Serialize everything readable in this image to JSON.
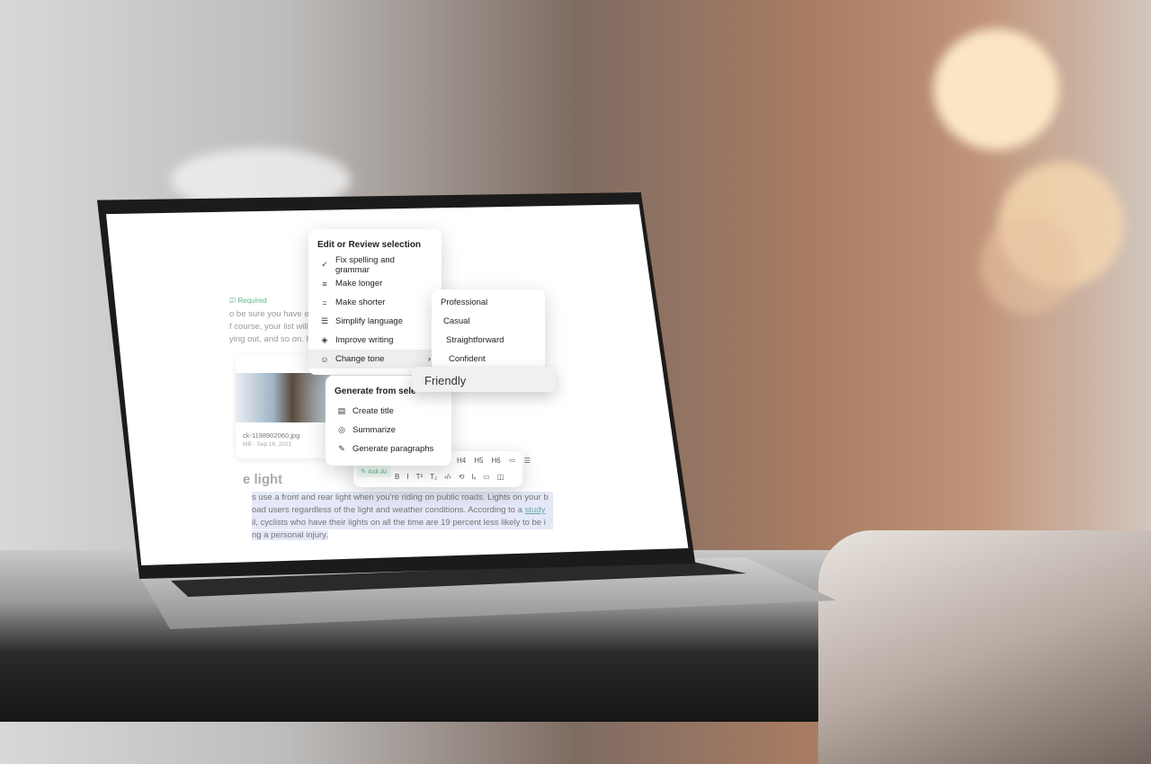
{
  "menu": {
    "edit_header": "Edit or Review selection",
    "items": [
      {
        "icon": "check-icon",
        "label": "Fix spelling and grammar"
      },
      {
        "icon": "lines-icon",
        "label": "Make longer"
      },
      {
        "icon": "short-lines-icon",
        "label": "Make shorter"
      },
      {
        "icon": "align-icon",
        "label": "Simplify language"
      },
      {
        "icon": "gem-icon",
        "label": "Improve writing"
      },
      {
        "icon": "smile-icon",
        "label": "Change tone"
      }
    ],
    "generate_header": "Generate from sele",
    "generate_items": [
      {
        "icon": "title-icon",
        "label": "Create title"
      },
      {
        "icon": "summary-icon",
        "label": "Summarize"
      },
      {
        "icon": "pen-icon",
        "label": "Generate paragraphs"
      }
    ]
  },
  "tone_menu": {
    "items": [
      "Professional",
      "Casual",
      "Straightforward",
      "Confident"
    ],
    "hovered": "Friendly"
  },
  "doc": {
    "required": "Required",
    "intro_lines": [
      "o be sure you have eve",
      "f course, your list will v",
      "ying out, and so on. Ho"
    ],
    "image_name": "ck-1198902060.jpg",
    "image_meta": "MB · Sep 16, 2021",
    "heading": "e light",
    "para_lines": [
      "s use a front and rear light when you're riding on public roads. Lights on your b",
      "oad users regardless of the light and weather conditions. According to a ",
      "il, cyclists who have their lights on all the time are 19 percent less likely to be i",
      "ng a personal injury."
    ],
    "link": "study"
  },
  "toolbar": {
    "ask_ai": "Ask AI",
    "row1": [
      "H4",
      "H5",
      "H6",
      "≔",
      "☰"
    ],
    "row2": [
      "B",
      "I",
      "T²",
      "T₂",
      "‹/›",
      "⟲",
      "Iₓ",
      "▭",
      "◫"
    ]
  }
}
